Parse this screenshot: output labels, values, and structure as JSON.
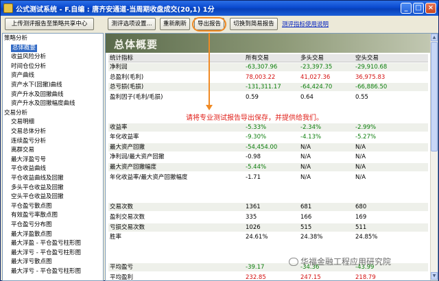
{
  "window": {
    "title": "公式测试系统 - F.自编 : 唐齐安通道-当周期收盘成交(20,1) 1分",
    "controls": [
      "_",
      "□",
      "×"
    ]
  },
  "toolbar": {
    "upload_label": "上传测评报告至策略共享中心",
    "settings_label": "测评选项设置...",
    "refresh_label": "重新刷新",
    "export_label": "导出报告",
    "simple_label": "切换到简易报告",
    "help_link": "测评指标使用说明"
  },
  "tree": {
    "items": [
      {
        "label": "策略分析",
        "indent": 0,
        "selected": false
      },
      {
        "label": "总体概要",
        "indent": 1,
        "selected": true
      },
      {
        "label": "收益风险分析",
        "indent": 1,
        "selected": false
      },
      {
        "label": "时间仓位分析",
        "indent": 1,
        "selected": false
      },
      {
        "label": "资产曲线",
        "indent": 1,
        "selected": false
      },
      {
        "label": "资产水下(回撤)曲线",
        "indent": 1,
        "selected": false
      },
      {
        "label": "资产升水及回撤曲线",
        "indent": 1,
        "selected": false
      },
      {
        "label": "资产升水及回撤幅度曲线",
        "indent": 1,
        "selected": false
      },
      {
        "label": "交易分析",
        "indent": 0,
        "selected": false
      },
      {
        "label": "交易明细",
        "indent": 1,
        "selected": false
      },
      {
        "label": "交易总体分析",
        "indent": 1,
        "selected": false
      },
      {
        "label": "连续盈亏分析",
        "indent": 1,
        "selected": false
      },
      {
        "label": "离群交易",
        "indent": 1,
        "selected": false
      },
      {
        "label": "最大浮盈亏号",
        "indent": 1,
        "selected": false
      },
      {
        "label": "平仓收益曲线",
        "indent": 1,
        "selected": false
      },
      {
        "label": "平仓收益曲线及回撤",
        "indent": 1,
        "selected": false
      },
      {
        "label": "多头平仓收益及回撤",
        "indent": 1,
        "selected": false
      },
      {
        "label": "空头平仓收益及回撤",
        "indent": 1,
        "selected": false
      },
      {
        "label": "平仓盈亏散点图",
        "indent": 1,
        "selected": false
      },
      {
        "label": "有效盈亏率散点图",
        "indent": 1,
        "selected": false
      },
      {
        "label": "平仓盈亏分布图",
        "indent": 1,
        "selected": false
      },
      {
        "label": "最大浮盈散点图",
        "indent": 1,
        "selected": false
      },
      {
        "label": "最大浮盈 - 平仓盈亏柱形图",
        "indent": 1,
        "selected": false
      },
      {
        "label": "最大浮亏 - 平仓盈亏柱形图",
        "indent": 1,
        "selected": false
      },
      {
        "label": "最大浮亏散点图",
        "indent": 1,
        "selected": false
      },
      {
        "label": "最大浮亏 - 平仓盈亏柱形图",
        "indent": 1,
        "selected": false
      }
    ]
  },
  "main": {
    "banner": "总体概要",
    "headers": [
      "统计指标",
      "所有交易",
      "多头交易",
      "空头交易"
    ],
    "rows": [
      {
        "label": "净利润",
        "values": [
          "-63,307.96",
          "-23,397.35",
          "-29,910.68"
        ],
        "styles": [
          "neg",
          "neg",
          "neg"
        ],
        "band": true
      },
      {
        "label": "总盈利(毛利)",
        "values": [
          "78,003.22",
          "41,027.36",
          "36,975.83"
        ],
        "styles": [
          "pos",
          "pos",
          "pos"
        ],
        "band": false
      },
      {
        "label": "总亏损(毛损)",
        "values": [
          "-131,311.17",
          "-64,424.70",
          "-66,886.50"
        ],
        "styles": [
          "neg",
          "neg",
          "neg"
        ],
        "band": true
      },
      {
        "label": "盈利因子(毛利/毛损)",
        "values": [
          "0.59",
          "0.64",
          "0.55"
        ],
        "styles": [
          "",
          "",
          ""
        ],
        "band": false
      },
      {
        "label": "",
        "values": [
          "",
          "",
          ""
        ],
        "styles": [
          "",
          "",
          ""
        ],
        "band": false
      },
      {
        "label": "",
        "values": [
          "",
          "",
          ""
        ],
        "styles": [
          "",
          "",
          ""
        ],
        "band": false
      },
      {
        "label": "收益率",
        "values": [
          "-5.33%",
          "-2.34%",
          "-2.99%"
        ],
        "styles": [
          "neg",
          "neg",
          "neg"
        ],
        "band": true
      },
      {
        "label": "年化收益率",
        "values": [
          "-9.30%",
          "-4.13%",
          "-5.27%"
        ],
        "styles": [
          "neg",
          "neg",
          "neg"
        ],
        "band": false
      },
      {
        "label": "最大资产回撤",
        "values": [
          "-54,454.00",
          "N/A",
          "N/A"
        ],
        "styles": [
          "neg",
          "",
          ""
        ],
        "band": true
      },
      {
        "label": "净利润/最大资产回撤",
        "values": [
          "-0.98",
          "N/A",
          "N/A"
        ],
        "styles": [
          "",
          "",
          ""
        ],
        "band": false
      },
      {
        "label": "最大资产回撤幅度",
        "values": [
          "-5.44%",
          "N/A",
          "N/A"
        ],
        "styles": [
          "neg",
          "",
          ""
        ],
        "band": true
      },
      {
        "label": "年化收益率/最大资产回撤幅度",
        "values": [
          "-1.71",
          "N/A",
          "N/A"
        ],
        "styles": [
          "",
          "",
          ""
        ],
        "band": false
      },
      {
        "label": "",
        "values": [
          "",
          "",
          ""
        ],
        "styles": [
          "",
          "",
          ""
        ],
        "band": false
      },
      {
        "label": "",
        "values": [
          "",
          "",
          ""
        ],
        "styles": [
          "",
          "",
          ""
        ],
        "band": false
      },
      {
        "label": "交易次数",
        "values": [
          "1361",
          "681",
          "680"
        ],
        "styles": [
          "",
          "",
          ""
        ],
        "band": true
      },
      {
        "label": "盈利交易次数",
        "values": [
          "335",
          "166",
          "169"
        ],
        "styles": [
          "",
          "",
          ""
        ],
        "band": false
      },
      {
        "label": "亏损交易次数",
        "values": [
          "1026",
          "515",
          "511"
        ],
        "styles": [
          "",
          "",
          ""
        ],
        "band": true
      },
      {
        "label": "胜率",
        "values": [
          "24.61%",
          "24.38%",
          "24.85%"
        ],
        "styles": [
          "",
          "",
          ""
        ],
        "band": false
      },
      {
        "label": "",
        "values": [
          "",
          "",
          ""
        ],
        "styles": [
          "",
          "",
          ""
        ],
        "band": false
      },
      {
        "label": "",
        "values": [
          "",
          "",
          ""
        ],
        "styles": [
          "",
          "",
          ""
        ],
        "band": false
      },
      {
        "label": "平均盈亏",
        "values": [
          "-39.17",
          "-34.36",
          "-43.99"
        ],
        "styles": [
          "neg",
          "neg",
          "neg"
        ],
        "band": true
      },
      {
        "label": "平均盈利",
        "values": [
          "232.85",
          "247.15",
          "218.79"
        ],
        "styles": [
          "pos",
          "pos",
          "pos"
        ],
        "band": false
      }
    ]
  },
  "annotation": "请将专业测试报告导出保存，并提供给我们。",
  "watermark": "华福金融工程应用研究院",
  "colors": {
    "negative": "#0a7d0a",
    "positive": "#d41010",
    "highlight": "#f08a24",
    "annotation": "#e0201a"
  }
}
